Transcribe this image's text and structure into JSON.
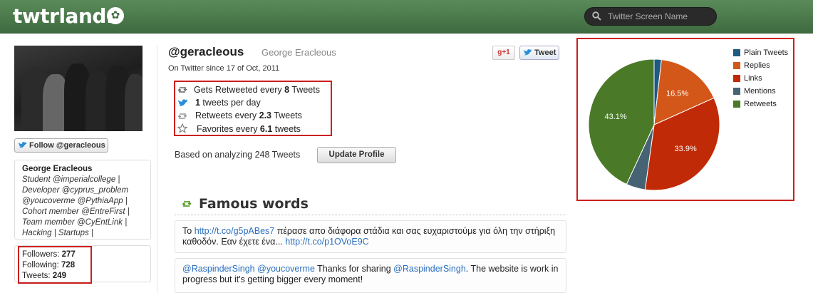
{
  "header": {
    "logo": "twtrland.",
    "search_placeholder": "Twitter Screen Name"
  },
  "sidebar": {
    "follow_label": "Follow @geracleous",
    "bio_name": "George Eracleous",
    "bio_lines": [
      "Student @imperialcollege |",
      "Developer @cyprus_problem",
      "@youcoverme @PythiaApp |",
      "Cohort member @EntreFirst |",
      "Team member @CyEntLink |",
      "Hacking | Startups |"
    ],
    "followers_label": "Followers:",
    "followers": "277",
    "following_label": "Following:",
    "following": "728",
    "tweets_label": "Tweets:",
    "tweets": "249"
  },
  "profile": {
    "handle": "@geracleous",
    "name": "George Eracleous",
    "since": "On Twitter since 17 of Oct, 2011",
    "gplus_label": "+1",
    "tweet_label": "Tweet"
  },
  "metrics": [
    {
      "pre": "Gets Retweeted every ",
      "val": "8",
      "post": " Tweets",
      "icon": "retweet-icon"
    },
    {
      "pre": "",
      "val": "1",
      "post": " tweets per day",
      "icon": "bird-icon"
    },
    {
      "pre": "Retweets every ",
      "val": "2.3",
      "post": " Tweets",
      "icon": "retweet-icon"
    },
    {
      "pre": "Favorites every ",
      "val": "6.1",
      "post": " tweets",
      "icon": "star-icon"
    }
  ],
  "based_on": "Based on analyzing 248 Tweets",
  "update_label": "Update Profile",
  "famous": {
    "title": "Famous words",
    "tweets": [
      {
        "parts": [
          {
            "t": "Το ",
            "link": false
          },
          {
            "t": "http://t.co/g5pABes7",
            "link": true
          },
          {
            "t": " πέρασε απο διάφορα στάδια και σας ευχαριστούμε για όλη την στήριξη καθοδόν. Εαν έχετε ένα... ",
            "link": false
          },
          {
            "t": "http://t.co/p1OVoE9C",
            "link": true
          }
        ]
      },
      {
        "parts": [
          {
            "t": "@RaspinderSingh",
            "link": true
          },
          {
            "t": " ",
            "link": false
          },
          {
            "t": "@youcoverme",
            "link": true
          },
          {
            "t": " Thanks for sharing ",
            "link": false
          },
          {
            "t": "@RaspinderSingh",
            "link": true
          },
          {
            "t": ". The website is work in progress but it's getting bigger every moment!",
            "link": false
          }
        ]
      }
    ]
  },
  "chart_data": {
    "type": "pie",
    "title": "",
    "legend_position": "top-right",
    "slices": [
      {
        "name": "Plain Tweets",
        "value": 1.8,
        "color": "#1f5a80",
        "label": ""
      },
      {
        "name": "Replies",
        "value": 16.5,
        "color": "#d4571a",
        "label": "16.5%"
      },
      {
        "name": "Links",
        "value": 33.9,
        "color": "#c02a06",
        "label": "33.9%"
      },
      {
        "name": "Mentions",
        "value": 4.7,
        "color": "#466374",
        "label": ""
      },
      {
        "name": "Retweets",
        "value": 43.1,
        "color": "#4a7a28",
        "label": "43.1%"
      }
    ]
  },
  "colors": {
    "header_green": "#3e6b3f",
    "link_blue": "#2a6fbf",
    "highlight_red": "#cc1f1f"
  }
}
